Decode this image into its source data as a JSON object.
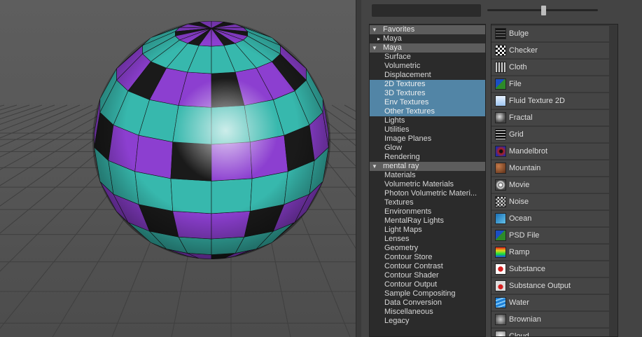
{
  "tree": {
    "favorites": {
      "label": "Favorites",
      "children": [
        "Maya"
      ]
    },
    "maya": {
      "label": "Maya",
      "items": [
        "Surface",
        "Volumetric",
        "Displacement",
        "2D Textures",
        "3D Textures",
        "Env Textures",
        "Other Textures",
        "Lights",
        "Utilities",
        "Image Planes",
        "Glow",
        "Rendering"
      ],
      "selected": [
        "2D Textures",
        "3D Textures",
        "Env Textures",
        "Other Textures"
      ]
    },
    "mental_ray": {
      "label": "mental ray",
      "items": [
        "Materials",
        "Volumetric Materials",
        "Photon Volumetric Materi...",
        "Textures",
        "Environments",
        "MentalRay Lights",
        "Light Maps",
        "Lenses",
        "Geometry",
        "Contour Store",
        "Contour Contrast",
        "Contour Shader",
        "Contour Output",
        "Sample Compositing",
        "Data Conversion",
        "Miscellaneous",
        "Legacy"
      ]
    }
  },
  "nodes": [
    {
      "label": "Bulge",
      "icon": "bulge-icon"
    },
    {
      "label": "Checker",
      "icon": "checker-icon"
    },
    {
      "label": "Cloth",
      "icon": "cloth-icon"
    },
    {
      "label": "File",
      "icon": "file-icon"
    },
    {
      "label": "Fluid Texture 2D",
      "icon": "fluid-texture-icon"
    },
    {
      "label": "Fractal",
      "icon": "fractal-icon"
    },
    {
      "label": "Grid",
      "icon": "grid-icon"
    },
    {
      "label": "Mandelbrot",
      "icon": "mandelbrot-icon"
    },
    {
      "label": "Mountain",
      "icon": "mountain-icon"
    },
    {
      "label": "Movie",
      "icon": "movie-icon"
    },
    {
      "label": "Noise",
      "icon": "noise-icon"
    },
    {
      "label": "Ocean",
      "icon": "ocean-icon"
    },
    {
      "label": "PSD File",
      "icon": "psd-file-icon"
    },
    {
      "label": "Ramp",
      "icon": "ramp-icon"
    },
    {
      "label": "Substance",
      "icon": "substance-icon"
    },
    {
      "label": "Substance Output",
      "icon": "substance-output-icon"
    },
    {
      "label": "Water",
      "icon": "water-icon"
    },
    {
      "label": "Brownian",
      "icon": "brownian-icon"
    },
    {
      "label": "Cloud",
      "icon": "cloud-icon"
    }
  ],
  "colors": {
    "selection": "#5285a6",
    "sphere_teal": "#37b8ad",
    "sphere_purple": "#8c3fd0"
  },
  "slider": {
    "value_fraction": 0.5
  }
}
